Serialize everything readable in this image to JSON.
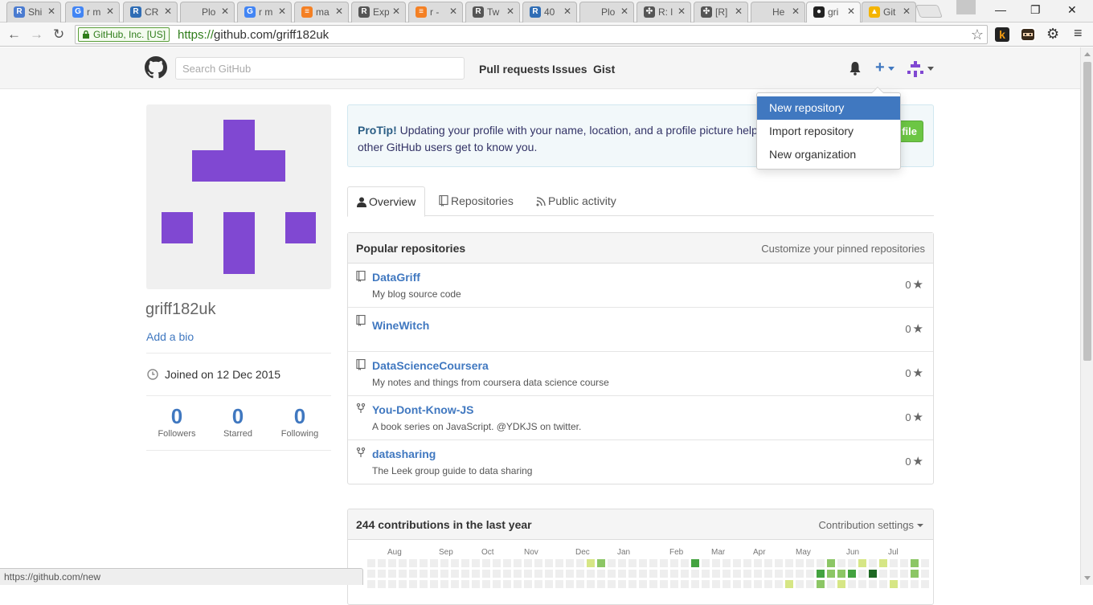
{
  "browser": {
    "tabs": [
      {
        "label": "Shi",
        "icon": "r-icon",
        "color": "#4a7bd0",
        "glyph": "R"
      },
      {
        "label": "r m",
        "icon": "google-icon",
        "color": "#4285f4",
        "glyph": "G"
      },
      {
        "label": "CR",
        "icon": "r-icon",
        "color": "#2f6db5",
        "glyph": "R"
      },
      {
        "label": "Plo",
        "icon": "blank-icon",
        "color": "#dcdcdc",
        "glyph": ""
      },
      {
        "label": "r m",
        "icon": "google-icon",
        "color": "#4285f4",
        "glyph": "G"
      },
      {
        "label": "ma",
        "icon": "stackoverflow-icon",
        "color": "#f48024",
        "glyph": "≡"
      },
      {
        "label": "Exp",
        "icon": "r-document-icon",
        "color": "#555555",
        "glyph": "R"
      },
      {
        "label": "r -",
        "icon": "stackoverflow-icon",
        "color": "#f48024",
        "glyph": "≡"
      },
      {
        "label": "Tw",
        "icon": "r-document-icon",
        "color": "#555555",
        "glyph": "R"
      },
      {
        "label": "40",
        "icon": "r-icon",
        "color": "#2f6db5",
        "glyph": "R"
      },
      {
        "label": "Plo",
        "icon": "blank-icon",
        "color": "#dcdcdc",
        "glyph": ""
      },
      {
        "label": "R: l",
        "icon": "r-help-icon",
        "color": "#555555",
        "glyph": "✣"
      },
      {
        "label": "[R]",
        "icon": "r-help-icon",
        "color": "#555555",
        "glyph": "✣"
      },
      {
        "label": "He",
        "icon": "page-icon",
        "color": "#dcdcdc",
        "glyph": ""
      },
      {
        "label": "gri",
        "icon": "github-icon",
        "color": "#222222",
        "glyph": "●",
        "active": true
      },
      {
        "label": "Git",
        "icon": "drive-icon",
        "color": "#f4b400",
        "glyph": "▲"
      }
    ],
    "close_glyph": "✕",
    "window": {
      "minimize": "—",
      "maximize": "❐",
      "close": "✕"
    },
    "secure_label": "GitHub, Inc. [US]",
    "url_scheme": "https://",
    "url_rest": "github.com/griff182uk",
    "status_url": "https://github.com/new"
  },
  "header": {
    "search_placeholder": "Search GitHub",
    "nav": [
      "Pull requests",
      "Issues",
      "Gist"
    ],
    "plus_glyph": "+"
  },
  "dropdown": {
    "items": [
      "New repository",
      "Import repository",
      "New organization"
    ],
    "highlighted_index": 0
  },
  "profile": {
    "username": "griff182uk",
    "add_bio": "Add a bio",
    "joined": "Joined on 12 Dec 2015",
    "stats": [
      {
        "value": "0",
        "label": "Followers"
      },
      {
        "value": "0",
        "label": "Starred"
      },
      {
        "value": "0",
        "label": "Following"
      }
    ],
    "identicon_color": "#8048d2"
  },
  "protip": {
    "bold": "ProTip!",
    "text": " Updating your profile with your name, location, and a profile picture helps other GitHub users get to know you.",
    "button_fragment": "file"
  },
  "tabs": [
    "Overview",
    "Repositories",
    "Public activity"
  ],
  "popular": {
    "title": "Popular repositories",
    "customize": "Customize your pinned repositories",
    "repos": [
      {
        "name": "DataGriff",
        "desc": "My blog source code",
        "stars": "0",
        "icon": "repo-icon"
      },
      {
        "name": "WineWitch",
        "desc": "",
        "stars": "0",
        "icon": "repo-icon"
      },
      {
        "name": "DataScienceCoursera",
        "desc": "My notes and things from coursera data science course",
        "stars": "0",
        "icon": "repo-icon"
      },
      {
        "name": "You-Dont-Know-JS",
        "desc": "A book series on JavaScript. @YDKJS on twitter.",
        "stars": "0",
        "icon": "fork-icon"
      },
      {
        "name": "datasharing",
        "desc": "The Leek group guide to data sharing",
        "stars": "0",
        "icon": "fork-icon"
      }
    ],
    "star_glyph": "★"
  },
  "contributions": {
    "title": "244 contributions in the last year",
    "settings": "Contribution settings",
    "months": [
      "Aug",
      "Sep",
      "Oct",
      "Nov",
      "Dec",
      "Jan",
      "Feb",
      "Mar",
      "Apr",
      "May",
      "Jun",
      "Jul"
    ],
    "colors": {
      "0": "#eeeeee",
      "1": "#d6e685",
      "2": "#8cc665",
      "3": "#44a340",
      "4": "#1e6823"
    },
    "rows_visible": [
      [
        0,
        0,
        0,
        0,
        0,
        0,
        0,
        0,
        0,
        0,
        0,
        0,
        0,
        0,
        0,
        0,
        0,
        0,
        0,
        0,
        0,
        1,
        2,
        0,
        0,
        0,
        0,
        0,
        0,
        0,
        0,
        3,
        0,
        0,
        0,
        0,
        0,
        0,
        0,
        0,
        0,
        0,
        0,
        0,
        2,
        0,
        0,
        1,
        0,
        1,
        0,
        0,
        2,
        0
      ],
      [
        0,
        0,
        0,
        0,
        0,
        0,
        0,
        0,
        0,
        0,
        0,
        0,
        0,
        0,
        0,
        0,
        0,
        0,
        0,
        0,
        0,
        0,
        0,
        0,
        0,
        0,
        0,
        0,
        0,
        0,
        0,
        0,
        0,
        0,
        0,
        0,
        0,
        0,
        0,
        0,
        0,
        0,
        0,
        3,
        2,
        2,
        3,
        0,
        4,
        0,
        0,
        0,
        2,
        0
      ],
      [
        0,
        0,
        0,
        0,
        0,
        0,
        0,
        0,
        0,
        0,
        0,
        0,
        0,
        0,
        0,
        0,
        0,
        0,
        0,
        0,
        0,
        0,
        0,
        0,
        0,
        0,
        0,
        0,
        0,
        0,
        0,
        0,
        0,
        0,
        0,
        0,
        0,
        0,
        0,
        0,
        1,
        0,
        0,
        2,
        0,
        1,
        0,
        0,
        0,
        0,
        1,
        0,
        0,
        0
      ]
    ]
  }
}
